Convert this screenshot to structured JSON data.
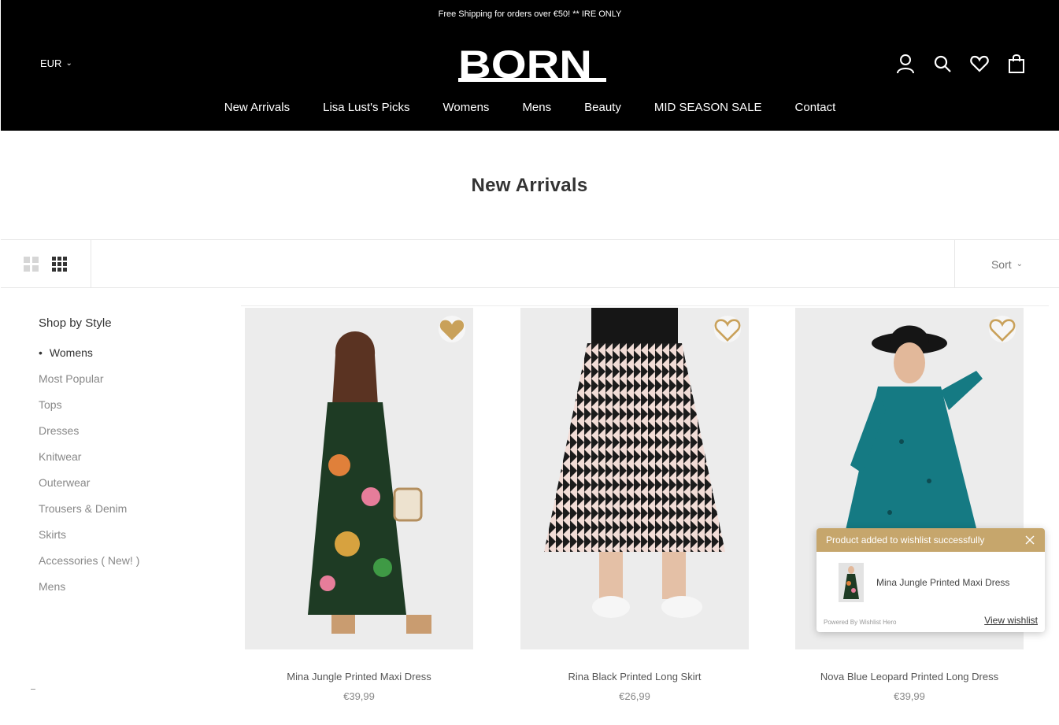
{
  "header": {
    "announcement": "Free Shipping for orders over €50! ** IRE ONLY",
    "currency": "EUR",
    "logo_text": "BORN",
    "nav": [
      "New Arrivals",
      "Lisa Lust's Picks",
      "Womens",
      "Mens",
      "Beauty",
      "MID SEASON SALE",
      "Contact"
    ],
    "icons": [
      "account-icon",
      "search-icon",
      "wishlist-heart-icon",
      "cart-bag-icon"
    ]
  },
  "page": {
    "title": "New Arrivals"
  },
  "toolbar": {
    "view_icons": [
      "grid-2-view-icon",
      "grid-3-view-icon"
    ],
    "sort_label": "Sort"
  },
  "sidebar": {
    "heading": "Shop by Style",
    "items": [
      "Womens",
      "Most Popular",
      "Tops",
      "Dresses",
      "Knitwear",
      "Outerwear",
      "Trousers & Denim",
      "Skirts",
      "Accessories ( New! )",
      "Mens"
    ],
    "active": "Womens"
  },
  "products": [
    {
      "name": "Mina Jungle Printed Maxi Dress",
      "price": "€39,99",
      "wishlisted": true
    },
    {
      "name": "Rina Black Printed Long Skirt",
      "price": "€26,99",
      "wishlisted": false
    },
    {
      "name": "Nova Blue Leopard Printed Long Dress",
      "price": "€39,99",
      "wishlisted": false
    }
  ],
  "toast": {
    "message": "Product added to wishlist successfully",
    "product_name": "Mina Jungle Printed Maxi Dress",
    "powered_by": "Powered By Wishlist Hero",
    "view_link": "View wishlist"
  },
  "colors": {
    "header_bg": "#000000",
    "accent_gold": "#c6a66c",
    "heart_filled": "#c9a15a"
  }
}
